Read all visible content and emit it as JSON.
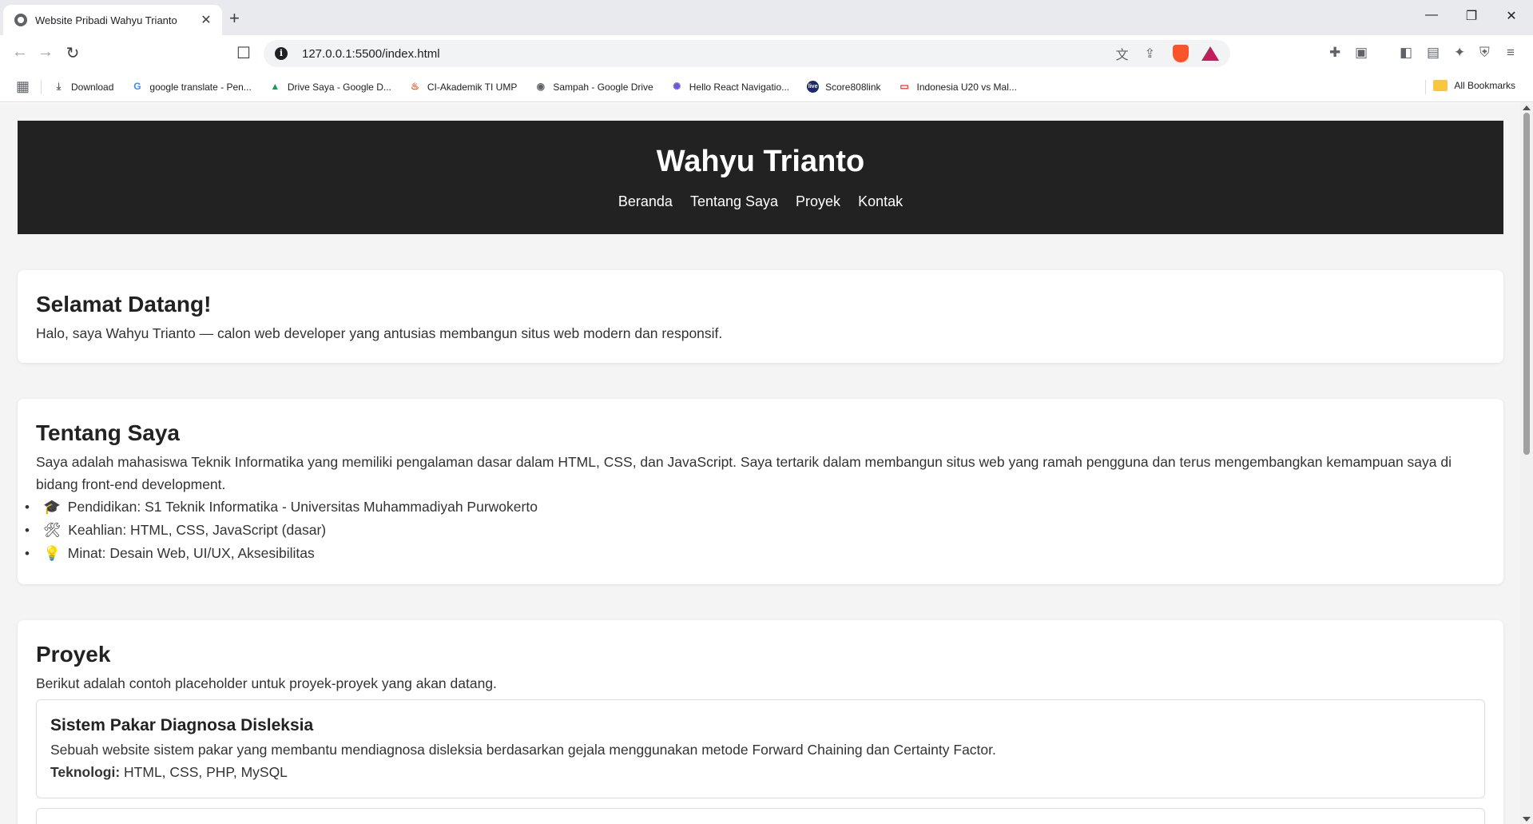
{
  "browser": {
    "tab_title": "Website Pribadi Wahyu Trianto",
    "url": "127.0.0.1:5500/index.html",
    "bookmarks": [
      {
        "label": "Download",
        "icon": "download-icon"
      },
      {
        "label": "google translate - Pen...",
        "icon": "google-icon"
      },
      {
        "label": "Drive Saya - Google D...",
        "icon": "drive-icon"
      },
      {
        "label": "CI-Akademik TI UMP",
        "icon": "fire-icon"
      },
      {
        "label": "Sampah - Google Drive",
        "icon": "globe-icon"
      },
      {
        "label": "Hello React Navigatio...",
        "icon": "react-icon"
      },
      {
        "label": "Score808link",
        "icon": "live-icon"
      },
      {
        "label": "Indonesia U20 vs Mal...",
        "icon": "tv-icon"
      }
    ],
    "all_bookmarks": "All Bookmarks"
  },
  "site": {
    "title": "Wahyu Trianto",
    "nav": [
      "Beranda",
      "Tentang Saya",
      "Proyek",
      "Kontak"
    ]
  },
  "welcome": {
    "heading": "Selamat Datang!",
    "text": "Halo, saya Wahyu Trianto — calon web developer yang antusias membangun situs web modern dan responsif."
  },
  "about": {
    "heading": "Tentang Saya",
    "text": "Saya adalah mahasiswa Teknik Informatika yang memiliki pengalaman dasar dalam HTML, CSS, dan JavaScript. Saya tertarik dalam membangun situs web yang ramah pengguna dan terus mengembangkan kemampuan saya di bidang front-end development.",
    "items": [
      {
        "icon": "🎓",
        "text": "Pendidikan: S1 Teknik Informatika - Universitas Muhammadiyah Purwokerto"
      },
      {
        "icon": "🛠",
        "text": "Keahlian: HTML, CSS, JavaScript (dasar)"
      },
      {
        "icon": "💡",
        "text": "Minat: Desain Web, UI/UX, Aksesibilitas"
      }
    ]
  },
  "projects": {
    "heading": "Proyek",
    "intro": "Berikut adalah contoh placeholder untuk proyek-proyek yang akan datang.",
    "items": [
      {
        "title": "Sistem Pakar Diagnosa Disleksia",
        "description": "Sebuah website sistem pakar yang membantu mendiagnosa disleksia berdasarkan gejala menggunakan metode Forward Chaining dan Certainty Factor.",
        "tech_label": "Teknologi:",
        "tech": "HTML, CSS, PHP, MySQL"
      }
    ]
  }
}
